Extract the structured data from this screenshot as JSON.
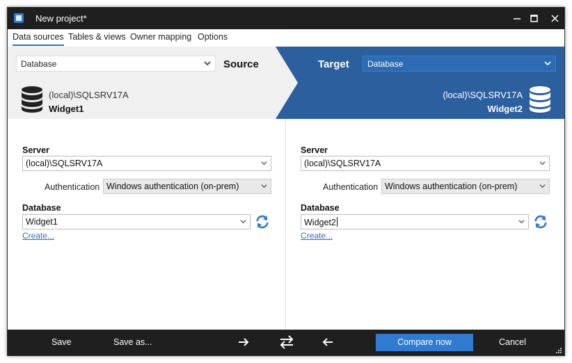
{
  "window": {
    "title": "New project*"
  },
  "tabs": [
    {
      "label": "Data sources",
      "active": true
    },
    {
      "label": "Tables & views"
    },
    {
      "label": "Owner mapping"
    },
    {
      "label": "Options"
    }
  ],
  "header": {
    "source": {
      "type_value": "Database",
      "label": "Source",
      "server": "(local)\\SQLSRV17A",
      "database": "Widget1"
    },
    "target": {
      "type_value": "Database",
      "label": "Target",
      "server": "(local)\\SQLSRV17A",
      "database": "Widget2"
    }
  },
  "source_panel": {
    "server_label": "Server",
    "server_value": "(local)\\SQLSRV17A",
    "auth_label": "Authentication",
    "auth_value": "Windows authentication (on-prem)",
    "database_label": "Database",
    "database_value": "Widget1",
    "create_link": "Create..."
  },
  "target_panel": {
    "server_label": "Server",
    "server_value": "(local)\\SQLSRV17A",
    "auth_label": "Authentication",
    "auth_value": "Windows authentication (on-prem)",
    "database_label": "Database",
    "database_value": "Widget2",
    "create_link": "Create..."
  },
  "footer": {
    "save": "Save",
    "save_as": "Save as...",
    "compare_now": "Compare now",
    "cancel": "Cancel"
  },
  "colors": {
    "accent": "#2f7bd1",
    "target_band": "#2b5f9e",
    "source_band": "#f0f0f0",
    "chrome": "#1f1f1f"
  }
}
